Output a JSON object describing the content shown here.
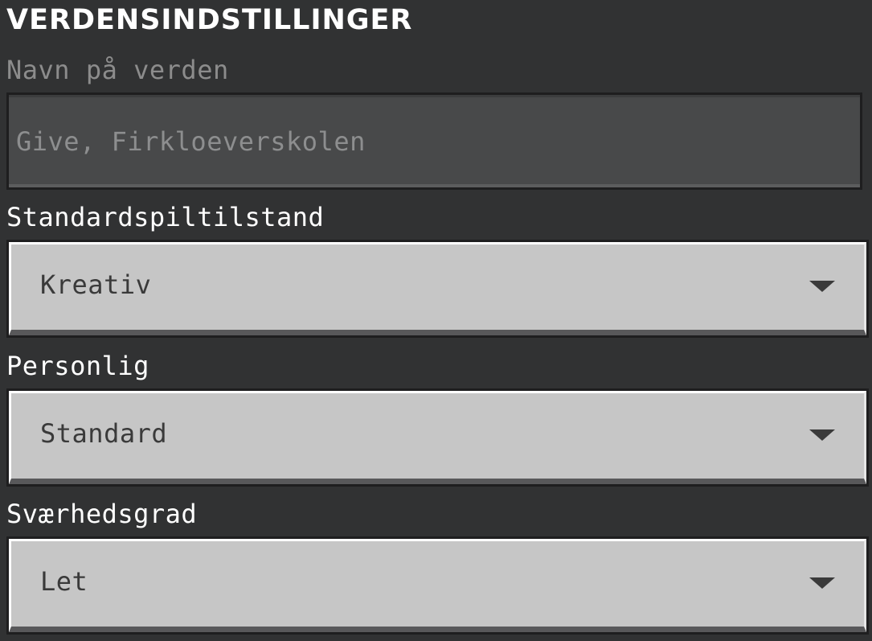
{
  "title": "VERDENSINDSTILLINGER",
  "world_name": {
    "label": "Navn på verden",
    "value": "Give, Firkloeverskolen"
  },
  "game_mode": {
    "label": "Standardspiltilstand",
    "value": "Kreativ",
    "icon": "chevron-down-icon"
  },
  "personal": {
    "label": "Personlig",
    "value": "Standard",
    "icon": "chevron-down-icon"
  },
  "difficulty": {
    "label": "Sværhedsgrad",
    "value": "Let",
    "icon": "chevron-down-icon"
  },
  "colors": {
    "background": "#313233",
    "field": "#48494a",
    "dropdown": "#c6c6c6",
    "text_dim": "#8c8c8c"
  }
}
